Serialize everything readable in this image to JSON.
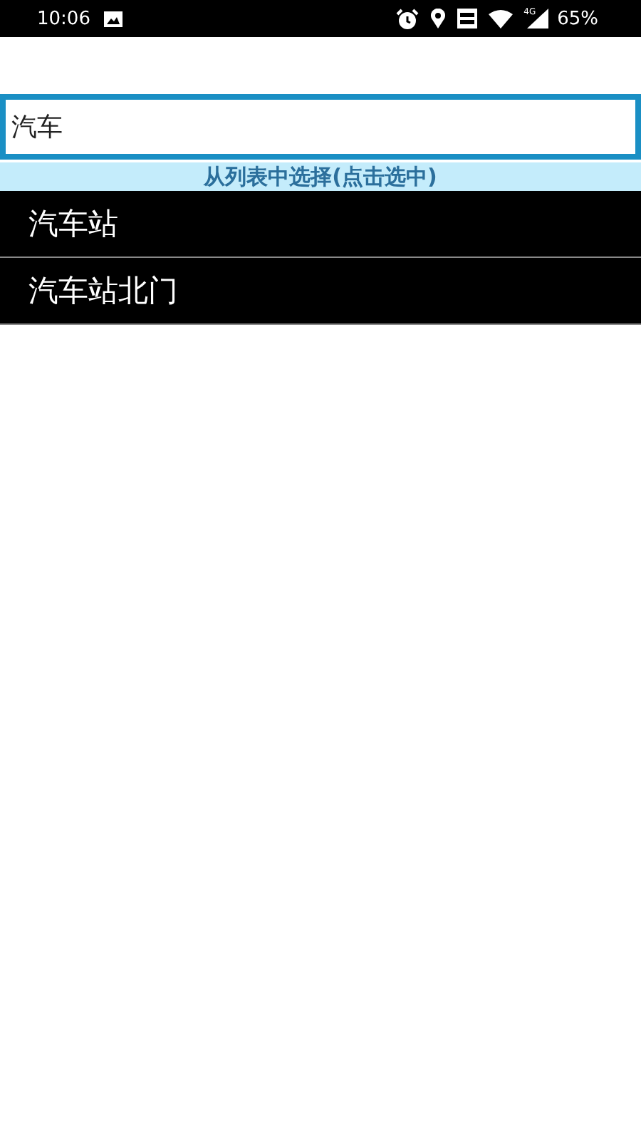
{
  "status_bar": {
    "time": "10:06",
    "network": "4G",
    "battery": "65%"
  },
  "search": {
    "value": "汽车"
  },
  "hint": "从列表中选择(点击选中)",
  "results": [
    {
      "label": "汽车站"
    },
    {
      "label": "汽车站北门"
    }
  ]
}
